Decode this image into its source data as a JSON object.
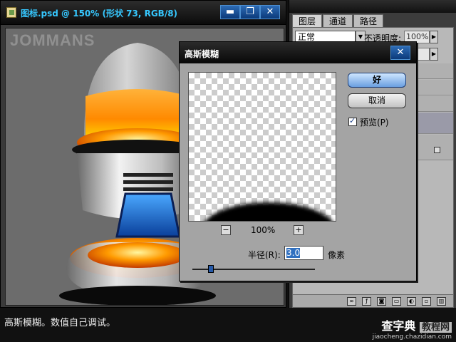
{
  "document": {
    "title": "图标.psd @ 150% (形状 73, RGB/8)",
    "watermark": "JOMMANS",
    "window_buttons": [
      "▬",
      "❐",
      "✕"
    ]
  },
  "layers_panel": {
    "tabs": [
      "图层",
      "通道",
      "路径"
    ],
    "blend_mode": "正常",
    "opacity_label": "不透明度:",
    "opacity_value": "100%",
    "fill_value": "",
    "footer_icons": [
      "link-icon",
      "fx-icon",
      "mask-icon",
      "folder-icon",
      "adjust-icon",
      "new-layer-icon",
      "trash-icon"
    ]
  },
  "dialog": {
    "title": "高斯模糊",
    "ok_label": "好",
    "cancel_label": "取消",
    "preview_label": "预览(P)",
    "preview_checked": true,
    "zoom_value": "100%",
    "zoom_minus": "−",
    "zoom_plus": "+",
    "radius_label": "半径(R):",
    "radius_value": "3.0",
    "radius_unit": "像素",
    "slider_fraction": 0.15
  },
  "caption": "高斯模糊。数值自己调试。",
  "site": {
    "name_a": "查字典",
    "name_b": "教程网",
    "url": "jiaocheng.chazidian.com"
  }
}
